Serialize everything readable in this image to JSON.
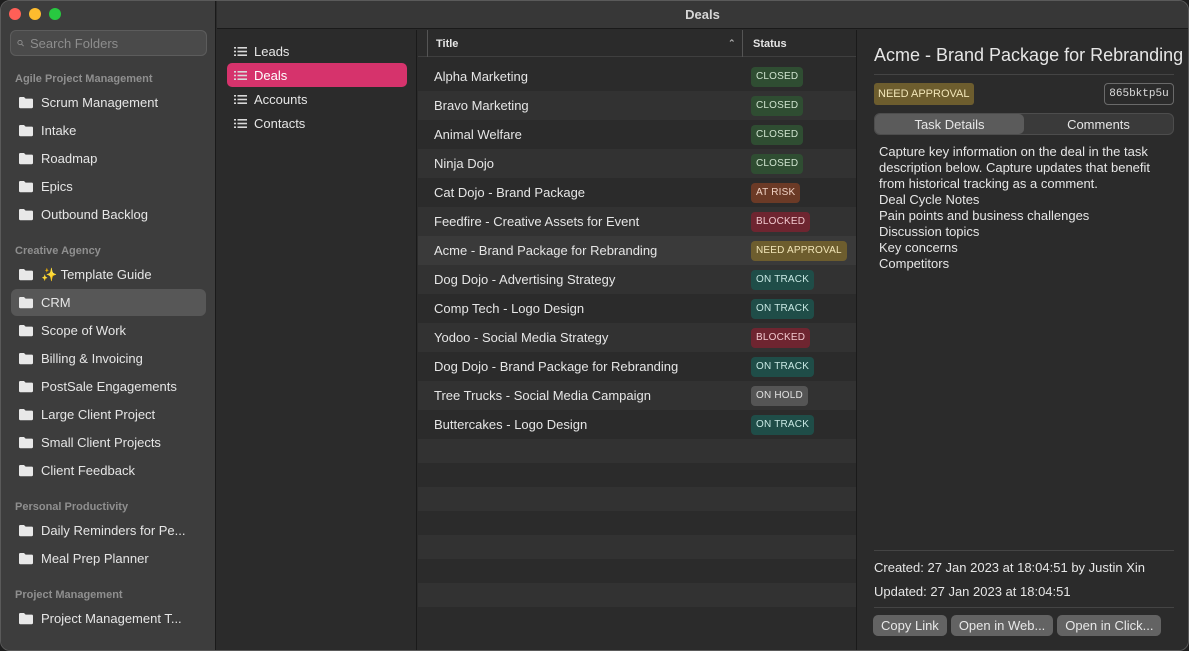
{
  "window": {
    "title": "Deals"
  },
  "sidebar": {
    "search_placeholder": "Search Folders",
    "groups": [
      {
        "title": "Agile Project Management",
        "items": [
          "Scrum Management",
          "Intake",
          "Roadmap",
          "Epics",
          "Outbound Backlog"
        ]
      },
      {
        "title": "Creative Agency",
        "items": [
          "✨ Template Guide",
          "CRM",
          "Scope of Work",
          "Billing & Invoicing",
          "PostSale Engagements",
          "Large Client Project",
          "Small Client Projects",
          "Client Feedback"
        ]
      },
      {
        "title": "Personal Productivity",
        "items": [
          "Daily Reminders for Pe...",
          "Meal Prep Planner"
        ]
      },
      {
        "title": "Project Management",
        "items": [
          "Project Management T..."
        ]
      }
    ],
    "selected": "CRM"
  },
  "views": {
    "items": [
      "Leads",
      "Deals",
      "Accounts",
      "Contacts"
    ],
    "active": "Deals"
  },
  "table": {
    "columns": {
      "title": "Title",
      "status": "Status",
      "sort_indicator": "⌃"
    },
    "rows": [
      {
        "title": "Alpha Marketing",
        "status": "CLOSED"
      },
      {
        "title": "Bravo Marketing",
        "status": "CLOSED"
      },
      {
        "title": "Animal Welfare",
        "status": "CLOSED"
      },
      {
        "title": "Ninja Dojo",
        "status": "CLOSED"
      },
      {
        "title": "Cat Dojo - Brand Package",
        "status": "AT RISK"
      },
      {
        "title": "Feedfire - Creative Assets for Event",
        "status": "BLOCKED"
      },
      {
        "title": "Acme - Brand Package for Rebranding",
        "status": "NEED APPROVAL"
      },
      {
        "title": "Dog Dojo - Advertising Strategy",
        "status": "ON TRACK"
      },
      {
        "title": "Comp Tech - Logo Design",
        "status": "ON TRACK"
      },
      {
        "title": "Yodoo - Social Media Strategy",
        "status": "BLOCKED"
      },
      {
        "title": "Dog Dojo - Brand Package for Rebranding",
        "status": "ON TRACK"
      },
      {
        "title": "Tree Trucks - Social Media Campaign",
        "status": "ON HOLD"
      },
      {
        "title": "Buttercakes - Logo Design",
        "status": "ON TRACK"
      }
    ],
    "selected_index": 6
  },
  "status_colors": {
    "CLOSED": {
      "bg": "#2f4d32",
      "fg": "#cfe3cf"
    },
    "AT RISK": {
      "bg": "#6b3a26",
      "fg": "#f0d2c4"
    },
    "BLOCKED": {
      "bg": "#6e2530",
      "fg": "#f2c9cf"
    },
    "NEED APPROVAL": {
      "bg": "#6d5d2e",
      "fg": "#f2e6b8"
    },
    "ON TRACK": {
      "bg": "#1f4d48",
      "fg": "#c9e9e4"
    },
    "ON HOLD": {
      "bg": "#555555",
      "fg": "#e2e2e2"
    }
  },
  "detail": {
    "title": "Acme - Brand Package for Rebranding",
    "status": "NEED APPROVAL",
    "task_id": "865bktp5u",
    "tabs": [
      "Task Details",
      "Comments"
    ],
    "active_tab": "Task Details",
    "description": [
      "Capture key information on the deal in the task description below. Capture updates that benefit from historical tracking as a comment.",
      "Deal Cycle Notes",
      "Pain points and business challenges",
      "Discussion topics",
      "Key concerns",
      "Competitors"
    ],
    "created": "Created: 27 Jan 2023 at 18:04:51 by Justin Xin",
    "updated": "Updated: 27 Jan 2023 at 18:04:51",
    "buttons": [
      "Copy Link",
      "Open in Web...",
      "Open in Click..."
    ]
  }
}
